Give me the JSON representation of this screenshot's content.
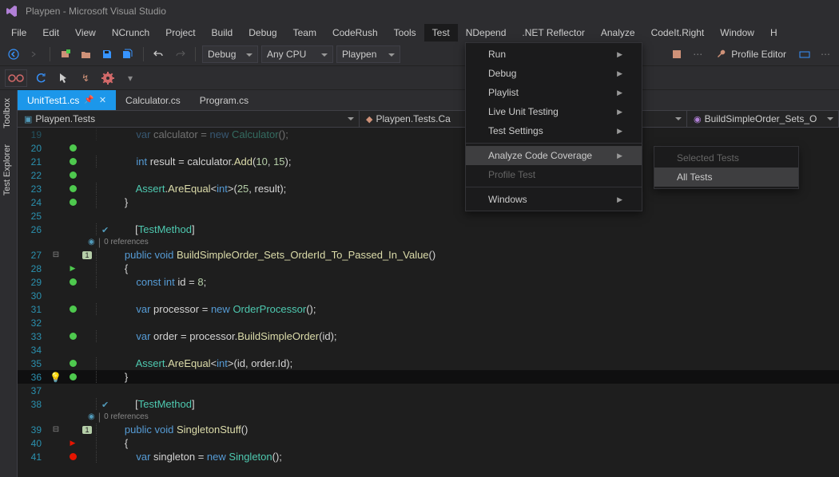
{
  "window": {
    "title": "Playpen - Microsoft Visual Studio"
  },
  "menubar": [
    "File",
    "Edit",
    "View",
    "NCrunch",
    "Project",
    "Build",
    "Debug",
    "Team",
    "CodeRush",
    "Tools",
    "Test",
    "NDepend",
    ".NET Reflector",
    "Analyze",
    "CodeIt.Right",
    "Window",
    "H"
  ],
  "toolbar": {
    "config": "Debug",
    "platform": "Any CPU",
    "startup": "Playpen",
    "profile_editor": "Profile Editor"
  },
  "tabs": [
    {
      "label": "UnitTest1.cs",
      "active": true,
      "pinned": true
    },
    {
      "label": "Calculator.cs",
      "active": false
    },
    {
      "label": "Program.cs",
      "active": false
    }
  ],
  "nav": {
    "scope": "Playpen.Tests",
    "class": "Playpen.Tests.Ca",
    "member": "BuildSimpleOrder_Sets_O"
  },
  "test_menu": {
    "items": [
      "Run",
      "Debug",
      "Playlist",
      "Live Unit Testing",
      "Test Settings",
      "Analyze Code Coverage",
      "Profile Test",
      "Windows"
    ],
    "highlighted": "Analyze Code Coverage",
    "disabled": [
      "Profile Test"
    ]
  },
  "coverage_submenu": {
    "items": [
      "Selected Tests",
      "All Tests"
    ],
    "highlighted": "All Tests",
    "disabled": [
      "Selected Tests"
    ]
  },
  "code_lines": [
    {
      "n": 19,
      "marker": "",
      "code_html": "            <span class='kw'>var</span> <span class='ident'>calculator</span> <span class='op'>=</span> <span class='kw'>new</span> <span class='type'>Calculator</span><span class='punc'>();</span>",
      "faded": true
    },
    {
      "n": 20,
      "marker": "green",
      "code_html": ""
    },
    {
      "n": 21,
      "marker": "green",
      "code_html": "            <span class='kw'>int</span> <span class='ident'>result</span> <span class='op'>=</span> <span class='ident'>calculator</span><span class='punc'>.</span><span class='method'>Add</span><span class='punc'>(</span><span class='num'>10</span><span class='punc'>, </span><span class='num'>15</span><span class='punc'>);</span>"
    },
    {
      "n": 22,
      "marker": "green",
      "code_html": ""
    },
    {
      "n": 23,
      "marker": "green",
      "code_html": "            <span class='type'>Assert</span><span class='punc'>.</span><span class='method'>AreEqual</span><span class='punc'>&lt;</span><span class='kw'>int</span><span class='punc'>&gt;(</span><span class='num'>25</span><span class='punc'>, </span><span class='ident'>result</span><span class='punc'>);</span>"
    },
    {
      "n": 24,
      "marker": "green",
      "code_html": "        <span class='punc'>}</span>"
    },
    {
      "n": 25,
      "marker": "",
      "code_html": ""
    },
    {
      "n": 26,
      "marker": "",
      "attr": true,
      "code_html": "        <span class='punc'>[</span><span class='type'>TestMethod</span><span class='punc'>]</span>"
    },
    {
      "codelens": true,
      "txt": "0 references"
    },
    {
      "n": 27,
      "marker": "",
      "collapse": "⊟",
      "ovl": "1",
      "code_html": "        <span class='kw'>public</span> <span class='kw'>void</span> <span class='method'>BuildSimpleOrder_Sets_OrderId_To_Passed_In_Value</span><span class='punc'>()</span>"
    },
    {
      "n": 28,
      "marker": "chev",
      "code_html": "        <span class='punc'>{</span>"
    },
    {
      "n": 29,
      "marker": "green",
      "code_html": "            <span class='kw'>const</span> <span class='kw'>int</span> <span class='ident'>id</span> <span class='op'>=</span> <span class='num'>8</span><span class='punc'>;</span>"
    },
    {
      "n": 30,
      "marker": "",
      "code_html": ""
    },
    {
      "n": 31,
      "marker": "green",
      "code_html": "            <span class='kw'>var</span> <span class='ident'>processor</span> <span class='op'>=</span> <span class='kw'>new</span> <span class='type'>OrderProcessor</span><span class='punc'>();</span>"
    },
    {
      "n": 32,
      "marker": "",
      "code_html": ""
    },
    {
      "n": 33,
      "marker": "green",
      "code_html": "            <span class='kw'>var</span> <span class='ident'>order</span> <span class='op'>=</span> <span class='ident'>processor</span><span class='punc'>.</span><span class='method'>BuildSimpleOrder</span><span class='punc'>(</span><span class='ident'>id</span><span class='punc'>);</span>"
    },
    {
      "n": 34,
      "marker": "",
      "code_html": ""
    },
    {
      "n": 35,
      "marker": "green",
      "code_html": "            <span class='type'>Assert</span><span class='punc'>.</span><span class='method'>AreEqual</span><span class='punc'>&lt;</span><span class='kw'>int</span><span class='punc'>&gt;(</span><span class='ident'>id</span><span class='punc'>, </span><span class='ident'>order</span><span class='punc'>.</span><span class='ident'>Id</span><span class='punc'>);</span>"
    },
    {
      "n": 36,
      "marker": "green",
      "bulb": true,
      "hl": true,
      "code_html": "        <span class='punc'>}</span>"
    },
    {
      "n": 37,
      "marker": "",
      "code_html": ""
    },
    {
      "n": 38,
      "marker": "",
      "attr": true,
      "code_html": "        <span class='punc'>[</span><span class='type'>TestMethod</span><span class='punc'>]</span>"
    },
    {
      "codelens": true,
      "txt": "0 references"
    },
    {
      "n": 39,
      "marker": "",
      "collapse": "⊟",
      "ovl": "1",
      "code_html": "        <span class='kw'>public</span> <span class='kw'>void</span> <span class='method'>SingletonStuff</span><span class='punc'>()</span>"
    },
    {
      "n": 40,
      "marker": "chev-red",
      "code_html": "        <span class='punc'>{</span>"
    },
    {
      "n": 41,
      "marker": "red",
      "code_html": "            <span class='kw'>var</span> <span class='ident'>singleton</span> <span class='op'>=</span> <span class='kw'>new</span> <span class='type'>Singleton</span><span class='punc'>();</span>"
    }
  ],
  "sidebar_tabs": [
    "Toolbox",
    "Test Explorer"
  ]
}
